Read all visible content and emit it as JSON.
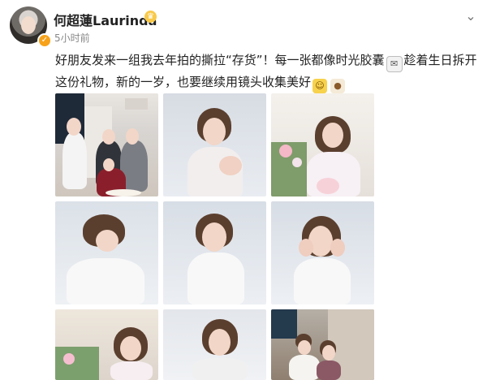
{
  "header": {
    "name": "何超蓮Laurinda",
    "time": "5小时前",
    "verified_symbol": "✓",
    "crown_symbol": "♛",
    "more_symbol": "⌄"
  },
  "post": {
    "text_1": "好朋友发来一组我去年拍的撕拉“存货”！每一张都像时光胶囊",
    "mail_emoji": "✉",
    "text_2": "趁着生日拆开这份礼物，新的一岁，也要继续用镜头收集美好",
    "smile_emoji": "☺",
    "cake_emoji": "●"
  },
  "colors": {
    "accent": "#f7a21a",
    "text": "#222222",
    "muted": "#888888"
  }
}
